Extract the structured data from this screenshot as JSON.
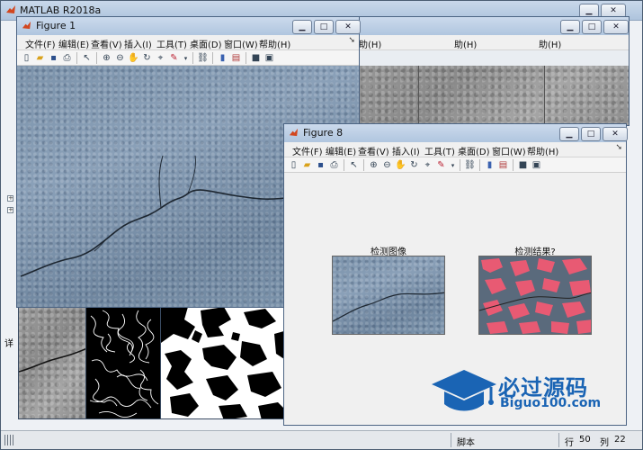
{
  "app": {
    "title": "MATLAB R2018a"
  },
  "window_buttons": {
    "minimize": "▁",
    "maximize": "□",
    "close": "✕"
  },
  "figure_menu": [
    "文件(F)",
    "编辑(E)",
    "查看(V)",
    "插入(I)",
    "工具(T)",
    "桌面(D)",
    "窗口(W)",
    "帮助(H)"
  ],
  "bg_menu_fragment": "助(H)",
  "figure1": {
    "title": "Figure 1"
  },
  "figure8": {
    "title": "Figure 8",
    "axes1_title": "检测图像",
    "axes2_title": "检测结果?"
  },
  "sidebar_fragment": "详",
  "statusbar": {
    "mode": "脚本",
    "row_label": "行",
    "row": "50",
    "col_label": "列",
    "col": "22"
  },
  "watermark": {
    "cn": "必过源码",
    "en": "Biguo100.com"
  },
  "toolbar_icons": [
    "new-file-icon",
    "open-folder-icon",
    "save-icon",
    "print-icon",
    "pointer-icon",
    "zoom-in-icon",
    "zoom-out-icon",
    "pan-icon",
    "rotate-icon",
    "data-cursor-icon",
    "brush-icon",
    "link-icon",
    "colorbar-icon",
    "legend-icon",
    "hide-plot-tools-icon",
    "show-plot-tools-icon"
  ],
  "colors": {
    "title_bar": "#b0c6df",
    "accent_blue": "#1a64b4",
    "crack_highlight": "#e85a73"
  }
}
